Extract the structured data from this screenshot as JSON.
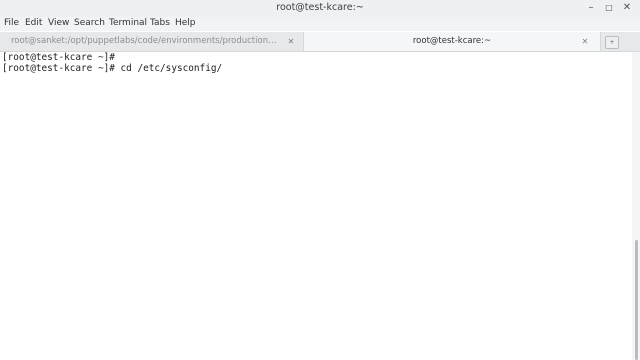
{
  "window": {
    "title": "root@test-kcare:~",
    "controls": {
      "minimize": "–",
      "maximize": "□",
      "close": "✕"
    }
  },
  "menubar": {
    "items": [
      "File",
      "Edit",
      "View",
      "Search",
      "Terminal",
      "Tabs",
      "Help"
    ]
  },
  "tabs": [
    {
      "label": "root@sanket:/opt/puppetlabs/code/environments/production/...",
      "active": false,
      "close": "✕"
    },
    {
      "label": "root@test-kcare:~",
      "active": true,
      "close": "✕"
    }
  ],
  "new_tab_icon": "+",
  "terminal": {
    "lines": [
      "[root@test-kcare ~]#",
      "[root@test-kcare ~]# cd /etc/sysconfig/"
    ]
  },
  "scrollbar": {
    "position_fraction": 1.0
  }
}
